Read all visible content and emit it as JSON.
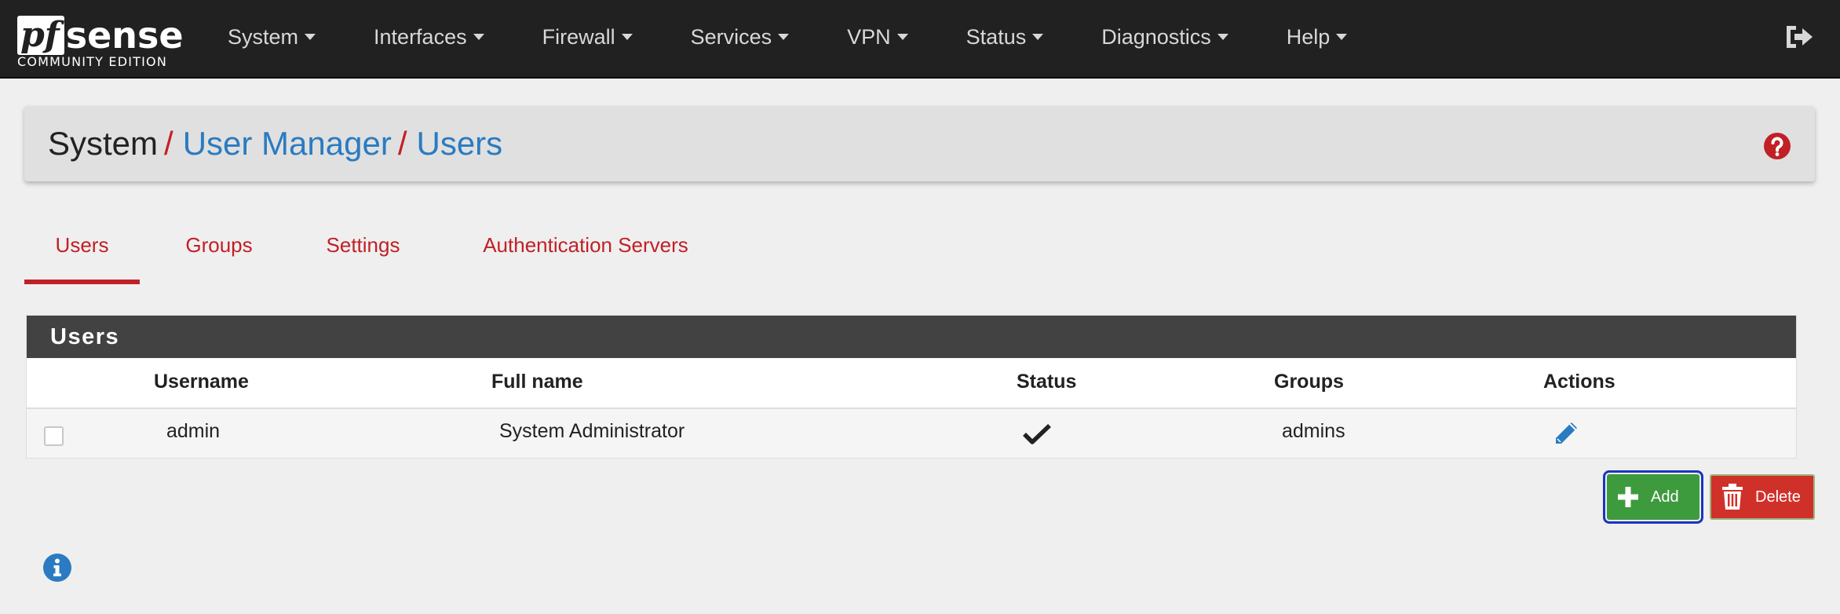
{
  "brand": {
    "logo_pf": "pf",
    "logo_sense": "sense",
    "edition": "COMMUNITY EDITION"
  },
  "nav": {
    "items": [
      {
        "label": "System"
      },
      {
        "label": "Interfaces"
      },
      {
        "label": "Firewall"
      },
      {
        "label": "Services"
      },
      {
        "label": "VPN"
      },
      {
        "label": "Status"
      },
      {
        "label": "Diagnostics"
      },
      {
        "label": "Help"
      }
    ],
    "logout_icon": "logout-icon"
  },
  "breadcrumb": {
    "root": "System",
    "separator": "/",
    "level2": "User Manager",
    "level3": "Users"
  },
  "tabs": [
    {
      "label": "Users",
      "active": true
    },
    {
      "label": "Groups",
      "active": false
    },
    {
      "label": "Settings",
      "active": false
    },
    {
      "label": "Authentication Servers",
      "active": false
    }
  ],
  "users_panel": {
    "title": "Users",
    "columns": [
      "Username",
      "Full name",
      "Status",
      "Groups",
      "Actions"
    ],
    "rows": [
      {
        "username": "admin",
        "full_name": "System Administrator",
        "status_icon": "check-icon",
        "groups": "admins",
        "action_icon": "pencil-icon"
      }
    ]
  },
  "buttons": {
    "add_label": "Add",
    "delete_label": "Delete"
  },
  "colors": {
    "navbar": "#212121",
    "accent_red": "#c12026",
    "link_blue": "#2a7bc1",
    "add_green": "#3d9b3d",
    "delete_red": "#d0302a",
    "panel_header": "#424242"
  }
}
